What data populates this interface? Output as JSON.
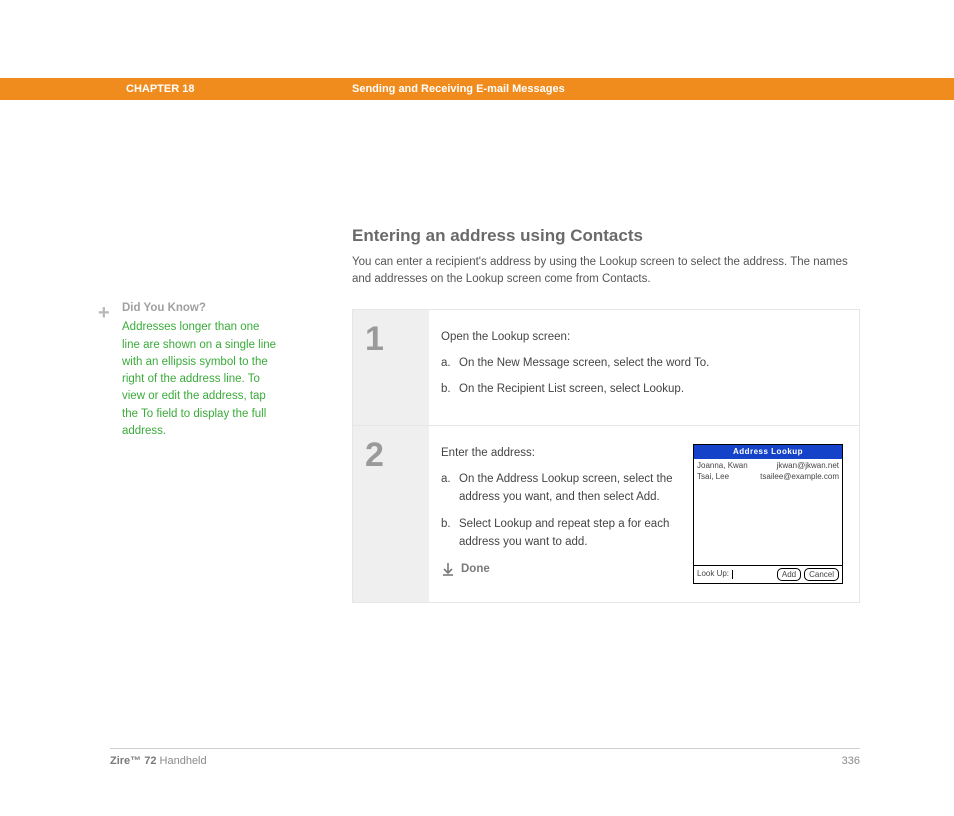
{
  "header": {
    "chapter": "CHAPTER 18",
    "title": "Sending and Receiving E-mail Messages"
  },
  "sidebar": {
    "dyk_title": "Did You Know?",
    "dyk_body": "Addresses longer than one line are shown on a single line with an ellipsis symbol to the right of the address line. To view or edit the address, tap the To field to display the full address."
  },
  "section": {
    "title": "Entering an address using Contacts",
    "intro": "You can enter a recipient's address by using the Lookup screen to select the address. The names and addresses on the Lookup screen come from Contacts."
  },
  "steps": {
    "one": {
      "num": "1",
      "lead": "Open the Lookup screen:",
      "a_marker": "a.",
      "a_text": "On the New Message screen, select the word To.",
      "b_marker": "b.",
      "b_text": "On the Recipient List screen, select Lookup."
    },
    "two": {
      "num": "2",
      "lead": "Enter the address:",
      "a_marker": "a.",
      "a_text": "On the Address Lookup screen, select the address you want, and then select Add.",
      "b_marker": "b.",
      "b_text": "Select Lookup and repeat step a for each address you want to add.",
      "done": "Done"
    }
  },
  "palm": {
    "title": "Address Lookup",
    "rows": [
      {
        "name": "Joanna, Kwan",
        "email": "jkwan@jkwan.net"
      },
      {
        "name": "Tsai, Lee",
        "email": "tsailee@example.com"
      }
    ],
    "lookup_label": "Look Up:",
    "add_btn": "Add",
    "cancel_btn": "Cancel"
  },
  "footer": {
    "product_bold": "Zire™ 72",
    "product_rest": " Handheld",
    "page": "336"
  }
}
